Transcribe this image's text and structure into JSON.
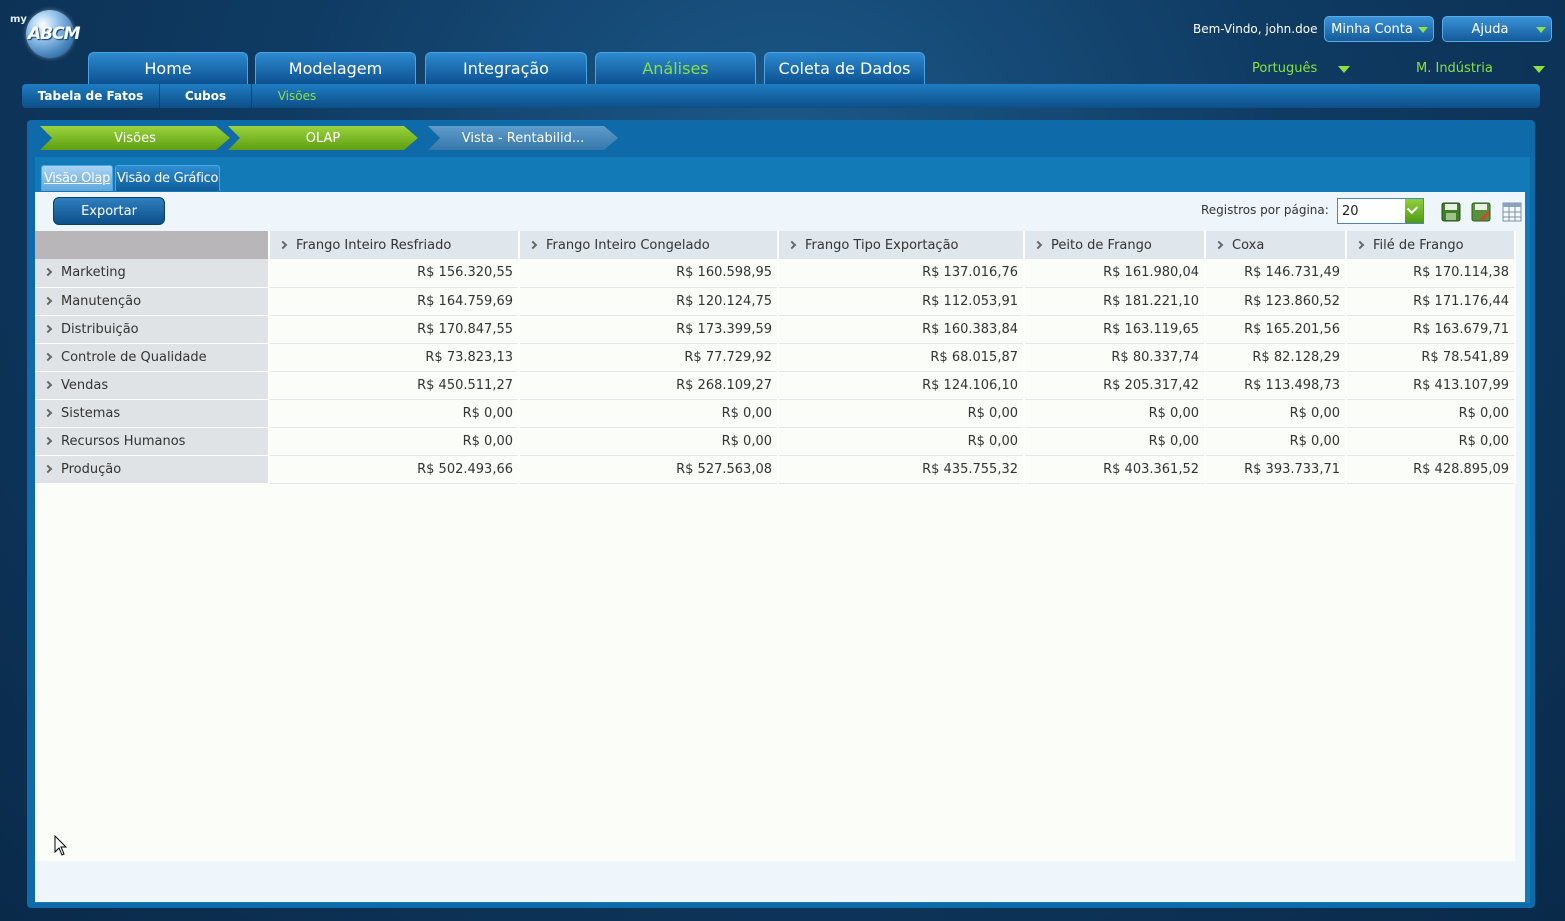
{
  "brand": {
    "prefix": "my",
    "name": "ABCM"
  },
  "header": {
    "welcome": "Bem-Vindo, john.doe",
    "account_button": "Minha Conta",
    "help_button": "Ajuda",
    "language": "Português",
    "company": "M. Indústria"
  },
  "main_nav": [
    {
      "label": "Home",
      "active": false
    },
    {
      "label": "Modelagem",
      "active": false
    },
    {
      "label": "Integração",
      "active": false
    },
    {
      "label": "Análises",
      "active": true
    },
    {
      "label": "Coleta de Dados",
      "active": false
    }
  ],
  "sub_nav": [
    {
      "label": "Tabela de Fatos",
      "active": false
    },
    {
      "label": "Cubos",
      "active": false
    },
    {
      "label": "Visões",
      "active": true
    }
  ],
  "breadcrumb": [
    "Visões",
    "OLAP",
    "Vista - Rentabilid..."
  ],
  "view_tabs": [
    {
      "label": "Visão Olap",
      "active": true
    },
    {
      "label": "Visão de Gráfico",
      "active": false
    }
  ],
  "toolbar": {
    "export_label": "Exportar",
    "records_label": "Registros por página:",
    "records_value": "20",
    "icons": [
      "save-icon",
      "edit-icon",
      "grid-layout-icon"
    ]
  },
  "colors": {
    "accent_green": "#8be041",
    "panel_blue": "#0e6aa8"
  },
  "table": {
    "columns": [
      "Frango Inteiro Resfriado",
      "Frango Inteiro Congelado",
      "Frango Tipo Exportação",
      "Peito de Frango",
      "Coxa",
      "Filé de Frango"
    ],
    "rows": [
      {
        "label": "Marketing",
        "values": [
          "R$ 156.320,55",
          "R$ 160.598,95",
          "R$ 137.016,76",
          "R$ 161.980,04",
          "R$ 146.731,49",
          "R$ 170.114,38"
        ]
      },
      {
        "label": "Manutenção",
        "values": [
          "R$ 164.759,69",
          "R$ 120.124,75",
          "R$ 112.053,91",
          "R$ 181.221,10",
          "R$ 123.860,52",
          "R$ 171.176,44"
        ]
      },
      {
        "label": "Distribuição",
        "values": [
          "R$ 170.847,55",
          "R$ 173.399,59",
          "R$ 160.383,84",
          "R$ 163.119,65",
          "R$ 165.201,56",
          "R$ 163.679,71"
        ]
      },
      {
        "label": "Controle de Qualidade",
        "values": [
          "R$ 73.823,13",
          "R$ 77.729,92",
          "R$ 68.015,87",
          "R$ 80.337,74",
          "R$ 82.128,29",
          "R$ 78.541,89"
        ]
      },
      {
        "label": "Vendas",
        "values": [
          "R$ 450.511,27",
          "R$ 268.109,27",
          "R$ 124.106,10",
          "R$ 205.317,42",
          "R$ 113.498,73",
          "R$ 413.107,99"
        ]
      },
      {
        "label": "Sistemas",
        "values": [
          "R$ 0,00",
          "R$ 0,00",
          "R$ 0,00",
          "R$ 0,00",
          "R$ 0,00",
          "R$ 0,00"
        ]
      },
      {
        "label": "Recursos Humanos",
        "values": [
          "R$ 0,00",
          "R$ 0,00",
          "R$ 0,00",
          "R$ 0,00",
          "R$ 0,00",
          "R$ 0,00"
        ]
      },
      {
        "label": "Produção",
        "values": [
          "R$ 502.493,66",
          "R$ 527.563,08",
          "R$ 435.755,32",
          "R$ 403.361,52",
          "R$ 393.733,71",
          "R$ 428.895,09"
        ]
      }
    ]
  }
}
